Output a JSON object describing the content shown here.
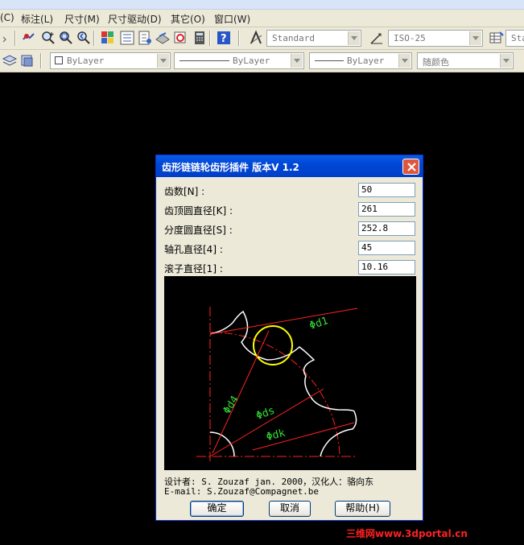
{
  "menu": {
    "items": [
      "(C)",
      "标注(L)",
      "尺寸(M)",
      "尺寸驱动(D)",
      "其它(O)",
      "窗口(W)"
    ]
  },
  "toolbar": {
    "text_style": "Standard",
    "dim_style": "ISO-25",
    "table_style_partial": "Sta",
    "layer_color": "ByLayer",
    "linetype": "ByLayer",
    "lineweight": "ByLayer",
    "plot_style": "随颜色"
  },
  "dialog": {
    "title": "齿形链链轮齿形插件 版本V 1.2",
    "fields": [
      {
        "label": "齿数[N] :",
        "value": "50"
      },
      {
        "label": "齿顶圆直径[K] :",
        "value": "261"
      },
      {
        "label": "分度圆直径[S] :",
        "value": "252.8"
      },
      {
        "label": "轴孔直径[4] :",
        "value": "45"
      },
      {
        "label": "滚子直径[1] :",
        "value": "10.16"
      }
    ],
    "drawing_labels": {
      "d1": "Φd1",
      "d4": "Φd4",
      "ds": "Φds",
      "dk": "Φdk"
    },
    "credit_line1": "设计者: S. Zouzaf jan. 2000，汉化人：骆向东",
    "credit_line2": "E-mail: S.Zouzaf@Compagnet.be",
    "buttons": {
      "ok": "确定",
      "cancel": "取消",
      "help": "帮助(H)"
    }
  },
  "watermark": "三维网www.3dportal.cn",
  "colors": {
    "dialog_title_bg": "#0047d6",
    "drawing_outline": "#ffffff",
    "drawing_roller": "#ffff00",
    "drawing_dim_line": "#ff2020",
    "drawing_label": "#33dd33"
  }
}
